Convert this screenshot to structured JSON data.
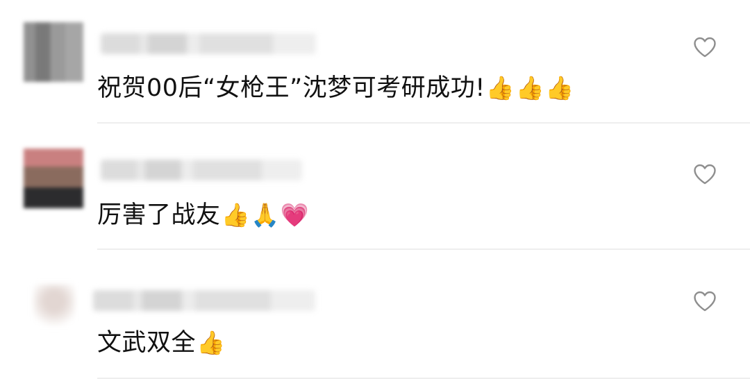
{
  "comments": [
    {
      "text": "祝贺00后“女枪王”沈梦可考研成功!",
      "emojis": [
        "👍",
        "👍",
        "👍"
      ]
    },
    {
      "text": "厉害了战友",
      "emojis": [
        "👍",
        "🙏",
        "💗"
      ]
    },
    {
      "text": "文武双全",
      "emojis": [
        "👍"
      ]
    }
  ],
  "icons": {
    "like": "heart-outline-icon"
  },
  "colors": {
    "text": "#111111",
    "like_outline": "#8e8e8e",
    "divider": "#eeeeee",
    "background": "#ffffff"
  }
}
